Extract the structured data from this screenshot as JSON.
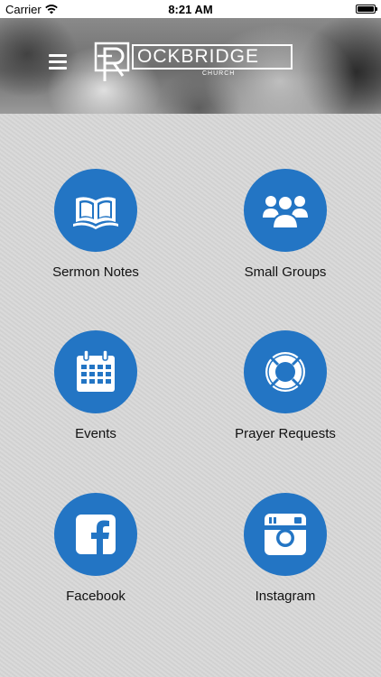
{
  "status_bar": {
    "carrier": "Carrier",
    "time": "8:21 AM",
    "battery_level": 1.0
  },
  "header": {
    "logo_text": "OCKBRIDGE",
    "logo_subtext": "CHURCH",
    "logo_mark": "R"
  },
  "tiles": [
    {
      "label": "Sermon Notes",
      "icon": "open-book-icon"
    },
    {
      "label": "Small Groups",
      "icon": "group-people-icon"
    },
    {
      "label": "Events",
      "icon": "calendar-icon"
    },
    {
      "label": "Prayer Requests",
      "icon": "lifebuoy-icon"
    },
    {
      "label": "Facebook",
      "icon": "facebook-icon"
    },
    {
      "label": "Instagram",
      "icon": "instagram-icon"
    }
  ],
  "colors": {
    "accent": "#2375c4",
    "background": "#d8d8d8",
    "header_text": "#ffffff"
  }
}
